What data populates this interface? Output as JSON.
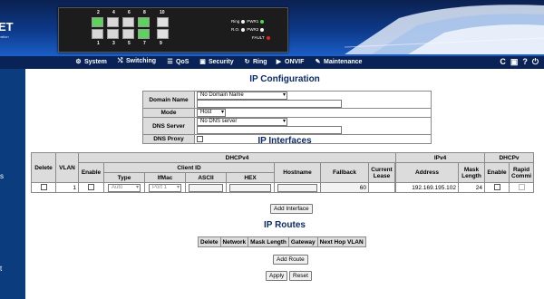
{
  "brand": {
    "name": "ET",
    "tagline": "ization"
  },
  "device": {
    "port_top": [
      "2",
      "4",
      "6",
      "8",
      "10"
    ],
    "port_bottom": [
      "1",
      "3",
      "5",
      "7",
      "9"
    ],
    "leds": [
      {
        "label": "Ring",
        "label2": "PWR1"
      },
      {
        "label": "R.O.",
        "label2": "PWR2"
      },
      {
        "label": "FAULT"
      }
    ]
  },
  "nav": {
    "items": [
      {
        "icon": "gear-icon",
        "glyph": "⚙",
        "label": "System"
      },
      {
        "icon": "switch-icon",
        "glyph": "⤭",
        "label": "Switching"
      },
      {
        "icon": "qos-icon",
        "glyph": "☰",
        "label": "QoS"
      },
      {
        "icon": "lock-icon",
        "glyph": "🔒",
        "label": "Security"
      },
      {
        "icon": "ring-icon",
        "glyph": "↻",
        "label": "Ring"
      },
      {
        "icon": "camera-icon",
        "glyph": "▶",
        "label": "ONVIF"
      },
      {
        "icon": "wrench-icon",
        "glyph": "✎",
        "label": "Maintenance"
      }
    ],
    "right": [
      "C",
      "▣",
      "?",
      "⏻"
    ]
  },
  "sidebar": {
    "items": [
      "s",
      "t"
    ]
  },
  "ip_config": {
    "title": "IP Configuration",
    "rows": [
      {
        "label": "Domain Name",
        "select": "No Domain Name"
      },
      {
        "label": "Mode",
        "select": "Host"
      },
      {
        "label": "DNS Server",
        "select": "No DNS server"
      },
      {
        "label": "DNS Proxy"
      }
    ]
  },
  "ip_interfaces": {
    "title": "IP Interfaces",
    "headers": {
      "delete": "Delete",
      "vlan": "VLAN",
      "dhcpv4": "DHCPv4",
      "enable": "Enable",
      "client_id": "Client ID",
      "type": "Type",
      "ifmac": "IfMac",
      "ascii": "ASCII",
      "hex": "HEX",
      "hostname": "Hostname",
      "fallback": "Fallback",
      "current_lease": "Current Lease",
      "ipv4": "IPv4",
      "address": "Address",
      "mask_length": "Mask Length",
      "dhcpv6": "DHCPv",
      "enable6": "Enable",
      "rapid_commit": "Rapid Commi"
    },
    "row": {
      "vlan": "1",
      "type": "Auto",
      "ifmac": "Port 1",
      "fallback": "60",
      "address": "192.169.195.102",
      "mask": "24"
    },
    "add_button": "Add Interface"
  },
  "ip_routes": {
    "title": "IP Routes",
    "headers": [
      "Delete",
      "Network",
      "Mask Length",
      "Gateway",
      "Next Hop VLAN"
    ],
    "add_button": "Add Route"
  },
  "buttons": {
    "apply": "Apply",
    "reset": "Reset"
  }
}
